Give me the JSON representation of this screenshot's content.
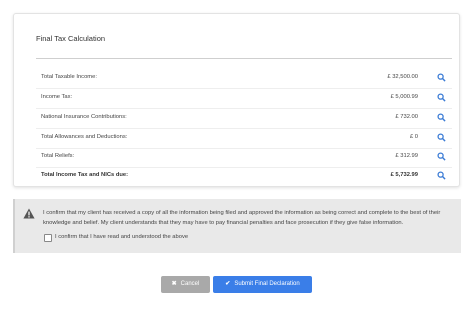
{
  "card": {
    "title": "Final Tax Calculation",
    "rows": [
      {
        "label": "Total Taxable Income:",
        "amount": "£ 32,500.00"
      },
      {
        "label": "Income Tax:",
        "amount": "£ 5,000.99"
      },
      {
        "label": "National Insurance Contributions:",
        "amount": "£ 732.00"
      },
      {
        "label": "Total Allowances and Deductions:",
        "amount": "£ 0"
      },
      {
        "label": "Total Reliefs:",
        "amount": "£ 312.99"
      },
      {
        "label": "Total Income Tax and NICs due:",
        "amount": "£ 5,732.99"
      }
    ],
    "row_icon": "search-icon"
  },
  "declaration": {
    "text": "I confirm that my client has received a copy of all the information being filed and approved the information as being correct and complete to the best of their knowledge and belief. My client understands that they may have to pay financial penalties and face prosecution if they give false information.",
    "checkbox_label": "I confirm that I have read and understood the above",
    "checkbox_checked": false,
    "icon": "warning-icon"
  },
  "buttons": {
    "cancel_label": "Cancel",
    "cancel_icon": "close-icon",
    "submit_label": "Submit Final Declaration",
    "submit_icon": "check-icon"
  },
  "colors": {
    "accent": "#3a7ee8",
    "cancel": "#a9a9a9",
    "search_icon": "#3a7bd5"
  }
}
